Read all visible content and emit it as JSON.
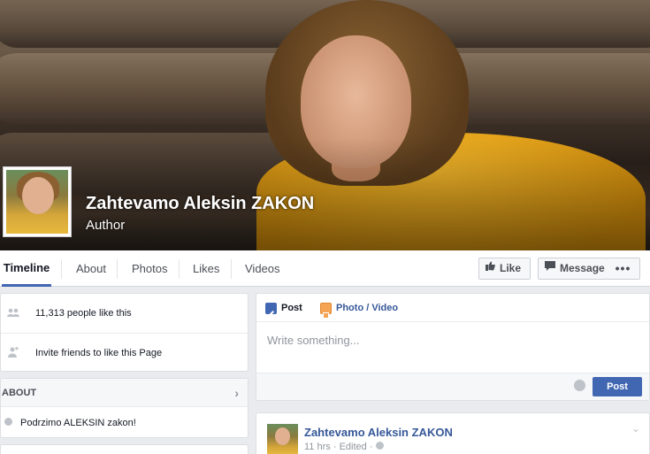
{
  "cover": {
    "page_name": "Zahtevamo Aleksin ZAKON",
    "category": "Author"
  },
  "nav": {
    "tabs": [
      "Timeline",
      "About",
      "Photos",
      "Likes",
      "Videos"
    ],
    "like_label": "Like",
    "message_label": "Message",
    "more_label": "•••"
  },
  "left": {
    "likes_text": "11,313 people like this",
    "invite_text": "Invite friends to like this Page",
    "about_title": "ABOUT",
    "about_text": "Podrzimo ALEKSIN zakon!"
  },
  "composer": {
    "post_tab": "Post",
    "photo_tab": "Photo / Video",
    "placeholder": "Write something...",
    "post_button": "Post"
  },
  "feed": {
    "author": "Zahtevamo Aleksin ZAKON",
    "time": "11 hrs",
    "edited": "Edited"
  },
  "colors": {
    "accent": "#4267b2",
    "link": "#365899",
    "background": "#e9ebee"
  }
}
